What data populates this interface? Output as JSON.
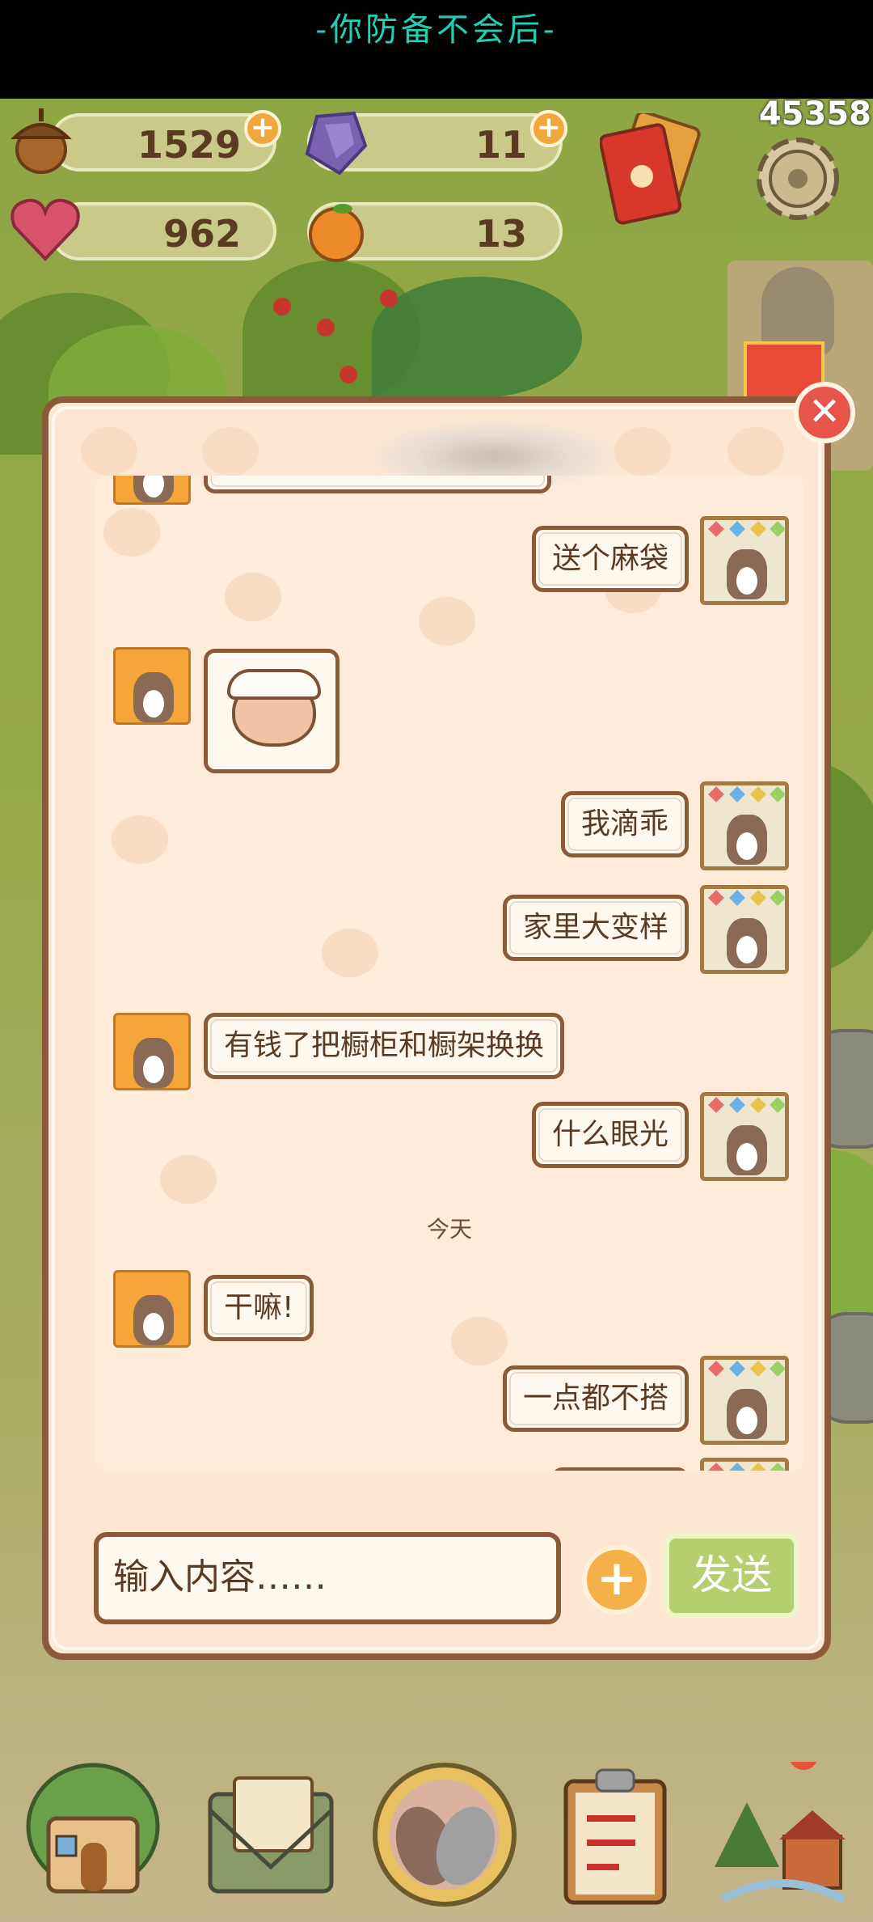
{
  "status_bar": {
    "marquee": "-你防备不会后-"
  },
  "resources": {
    "acorn": "1529",
    "gem": "11",
    "heart": "962",
    "orange": "13",
    "score": "45358"
  },
  "colors": {
    "accent": "#8a5a3a",
    "send": "#b6cf6e",
    "close": "#e6544a",
    "plus": "#f0a83c"
  },
  "chat": {
    "date_today": "今天",
    "messages": [
      {
        "side": "right",
        "text": "送个麻袋"
      },
      {
        "side": "left",
        "sticker": "bandaged-bun-sticker"
      },
      {
        "side": "right",
        "text": "我滴乖"
      },
      {
        "side": "right",
        "text": "家里大变样"
      },
      {
        "side": "left",
        "text": "有钱了把橱柜和橱架换换"
      },
      {
        "side": "right",
        "text": "什么眼光"
      },
      {
        "side": "left",
        "text": "干嘛!"
      },
      {
        "side": "right",
        "text": "一点都不搭"
      }
    ]
  },
  "composer": {
    "placeholder": "输入内容……",
    "send_label": "发送"
  },
  "nav": [
    "house-icon",
    "letter-icon",
    "paw-icon",
    "checklist-icon",
    "map-icon"
  ]
}
